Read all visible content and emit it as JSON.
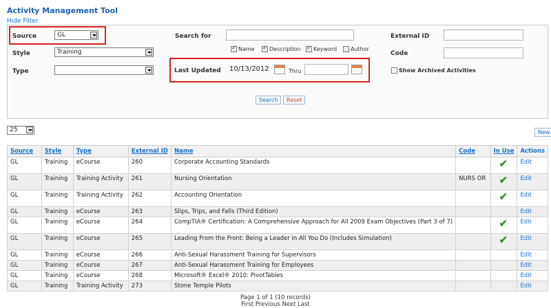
{
  "header": {
    "title": "Activity Management Tool",
    "hide_filter": "Hide Filter"
  },
  "filter": {
    "source_label": "Source",
    "source_value": "GL",
    "style_label": "Style",
    "style_value": "Training",
    "type_label": "Type",
    "type_value": "",
    "search_label": "Search for",
    "search_value": "",
    "checks": [
      {
        "label": "Name",
        "checked": true
      },
      {
        "label": "Description",
        "checked": true
      },
      {
        "label": "Keyword",
        "checked": true
      },
      {
        "label": "Author",
        "checked": false
      }
    ],
    "last_updated_label": "Last Updated",
    "last_updated_value": "10/13/2012",
    "thru_label": "Thru",
    "thru_value": "",
    "external_id_label": "External ID",
    "external_id_value": "",
    "code_label": "Code",
    "code_value": "",
    "archived_label": "Show Archived Activities",
    "search_button": "Search",
    "reset_button": "Reset"
  },
  "page_size": "25",
  "new_button": "New",
  "table": {
    "columns": [
      "Source",
      "Style",
      "Type",
      "External ID",
      "Name",
      "Code",
      "In Use",
      "Actions"
    ],
    "rows": [
      {
        "source": "GL",
        "style": "Training",
        "type": "eCourse",
        "ext": "260",
        "name": "Corporate Accounting Standards",
        "code": "",
        "in_use": true,
        "action": "Edit"
      },
      {
        "source": "GL",
        "style": "Training",
        "type": "Training Activity",
        "ext": "261",
        "name": "Nursing Orientation",
        "code": "NURS OR",
        "in_use": true,
        "action": "Edit"
      },
      {
        "source": "GL",
        "style": "Training",
        "type": "Training Activity",
        "ext": "262",
        "name": "Accounting Orientation",
        "code": "",
        "in_use": true,
        "action": "Edit"
      },
      {
        "source": "GL",
        "style": "Training",
        "type": "eCourse",
        "ext": "263",
        "name": "Slips, Trips, and Falls (Third Edition)",
        "code": "",
        "in_use": false,
        "action": "Edit"
      },
      {
        "source": "GL",
        "style": "Training",
        "type": "eCourse",
        "ext": "264",
        "name": "CompTIA® Certification: A Comprehensive Approach for All 2009 Exam Objectives (Part 3 of 7)",
        "code": "",
        "in_use": true,
        "action": "Edit"
      },
      {
        "source": "GL",
        "style": "Training",
        "type": "eCourse",
        "ext": "265",
        "name": "Leading From the Front: Being a Leader in All You Do (Includes Simulation)",
        "code": "",
        "in_use": true,
        "action": "Edit"
      },
      {
        "source": "GL",
        "style": "Training",
        "type": "eCourse",
        "ext": "266",
        "name": "Anti-Sexual Harassment Training for Supervisors",
        "code": "",
        "in_use": false,
        "action": "Edit"
      },
      {
        "source": "GL",
        "style": "Training",
        "type": "eCourse",
        "ext": "267",
        "name": "Anti-Sexual Harassment Training for Employees",
        "code": "",
        "in_use": false,
        "action": "Edit"
      },
      {
        "source": "GL",
        "style": "Training",
        "type": "eCourse",
        "ext": "268",
        "name": "Microsoft® Excel® 2010: PivotTables",
        "code": "",
        "in_use": false,
        "action": "Edit"
      },
      {
        "source": "GL",
        "style": "Training",
        "type": "Training Activity",
        "ext": "273",
        "name": "Stone Temple Pilots",
        "code": "",
        "in_use": false,
        "action": "Edit"
      }
    ]
  },
  "pager": {
    "summary": "Page 1 of 1 (10 records)",
    "first": "First",
    "previous": "Previous",
    "next": "Next",
    "last": "Last"
  },
  "colors": {
    "link": "#1a6fc4",
    "title": "#1a5fb4",
    "highlight_box": "#d62020",
    "check": "#2a9a1e"
  }
}
